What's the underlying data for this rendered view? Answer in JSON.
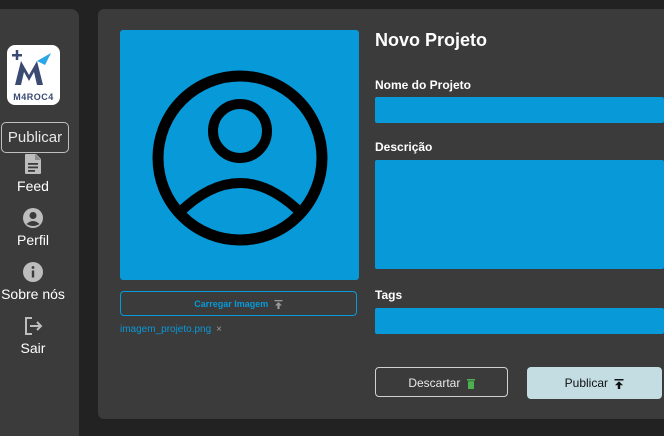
{
  "sidebar": {
    "logo_text": "M4ROC4",
    "publish_label": "Publicar",
    "items": [
      {
        "label": "Feed",
        "icon": "document-icon"
      },
      {
        "label": "Perfil",
        "icon": "user-icon"
      },
      {
        "label": "Sobre nós",
        "icon": "info-icon"
      },
      {
        "label": "Sair",
        "icon": "logout-icon"
      }
    ]
  },
  "project": {
    "title": "Novo Projeto",
    "upload_label": "Carregar Imagem",
    "file_name": "imagem_projeto.png",
    "file_remove": "×",
    "name_label": "Nome do Projeto",
    "name_value": "",
    "description_label": "Descrição",
    "description_value": "",
    "tags_label": "Tags",
    "tags_value": "",
    "discard_label": "Descartar",
    "publish_label": "Publicar"
  },
  "colors": {
    "accent": "#0799d8",
    "background": "#222222",
    "panel": "#3c3b3b",
    "publish_button": "#c3dde3",
    "trash": "#4caf50"
  }
}
